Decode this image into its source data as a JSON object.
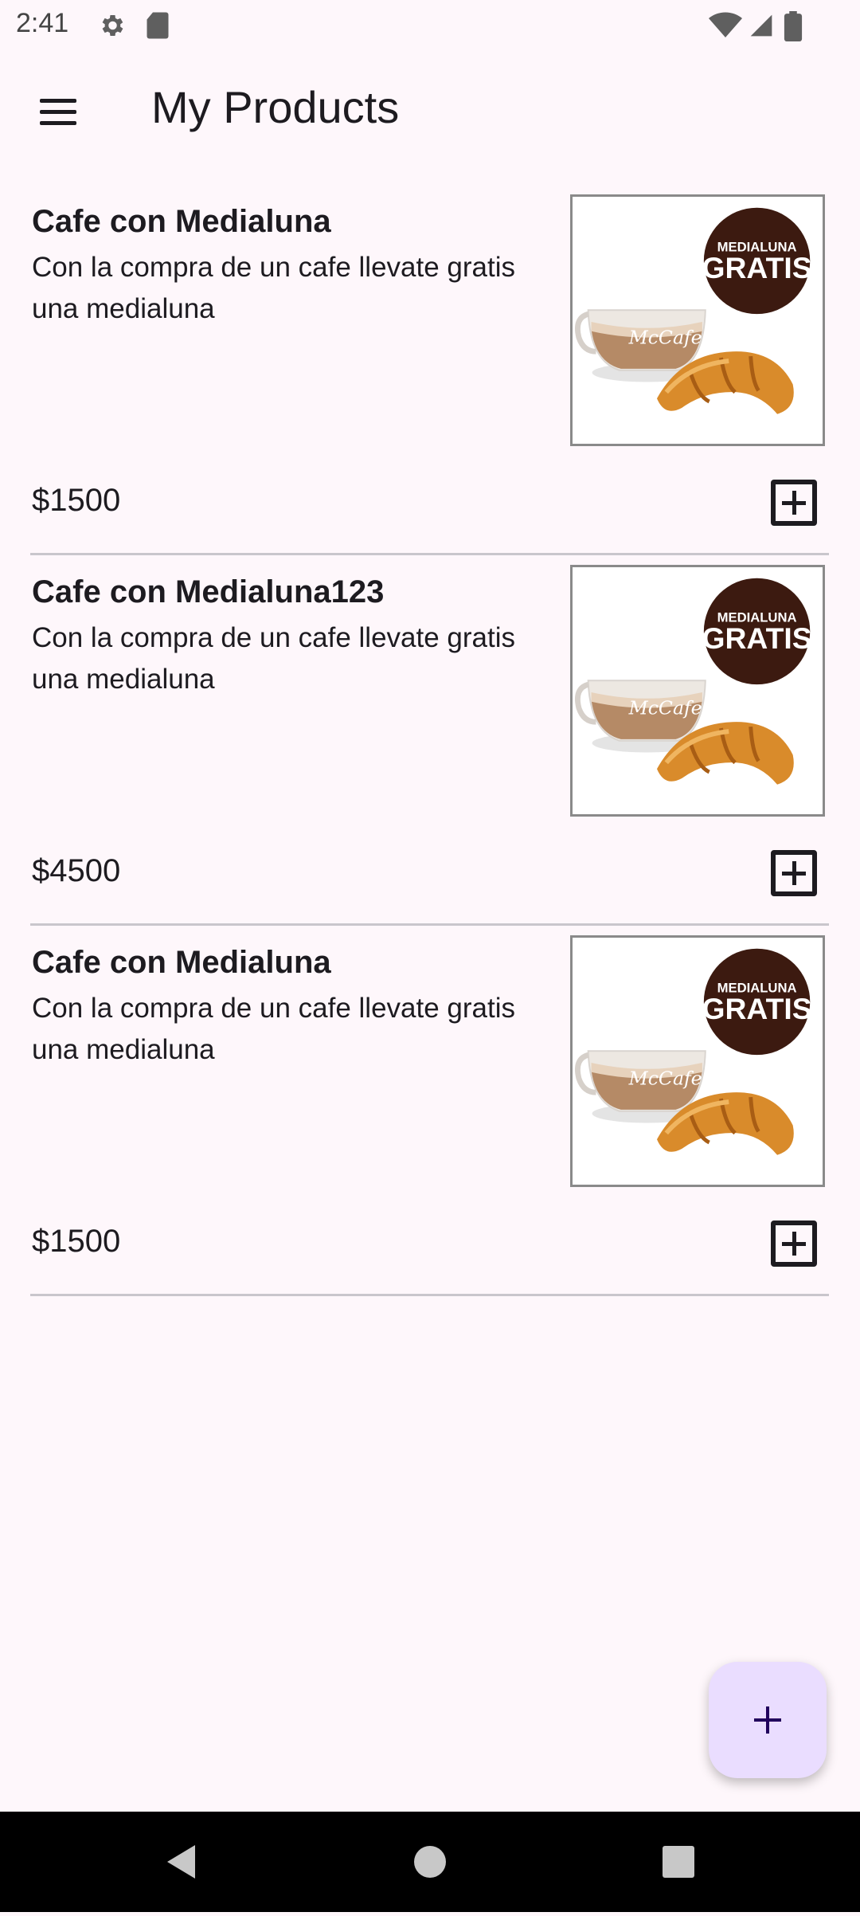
{
  "status_bar": {
    "time": "2:41",
    "icons": [
      "gear-icon",
      "sd-card-icon",
      "wifi-icon",
      "signal-icon",
      "battery-icon"
    ]
  },
  "app_bar": {
    "title": "My Products",
    "menu_icon": "hamburger-menu-icon"
  },
  "products": [
    {
      "name": "Cafe con Medialuna",
      "description": "Con la compra de un cafe llevate gratis una medialuna",
      "price": "$1500",
      "badge_top": "MEDIALUNA",
      "badge_bottom": "GRATIS",
      "cup_label": "McCafe"
    },
    {
      "name": "Cafe con Medialuna123",
      "description": "Con la compra de un cafe llevate gratis una medialuna",
      "price": "$4500",
      "badge_top": "MEDIALUNA",
      "badge_bottom": "GRATIS",
      "cup_label": "McCafe"
    },
    {
      "name": "Cafe con Medialuna",
      "description": "Con la compra de un cafe llevate gratis una medialuna",
      "price": "$1500",
      "badge_top": "MEDIALUNA",
      "badge_bottom": "GRATIS",
      "cup_label": "McCafe"
    }
  ],
  "fab": {
    "icon": "plus-icon"
  },
  "nav_bar": {
    "icons": [
      "back-triangle-icon",
      "home-circle-icon",
      "recents-square-icon"
    ]
  },
  "colors": {
    "background": "#fef7fb",
    "fab_background": "#eaddff",
    "fab_icon": "#21005d",
    "badge": "#3c1a10"
  }
}
